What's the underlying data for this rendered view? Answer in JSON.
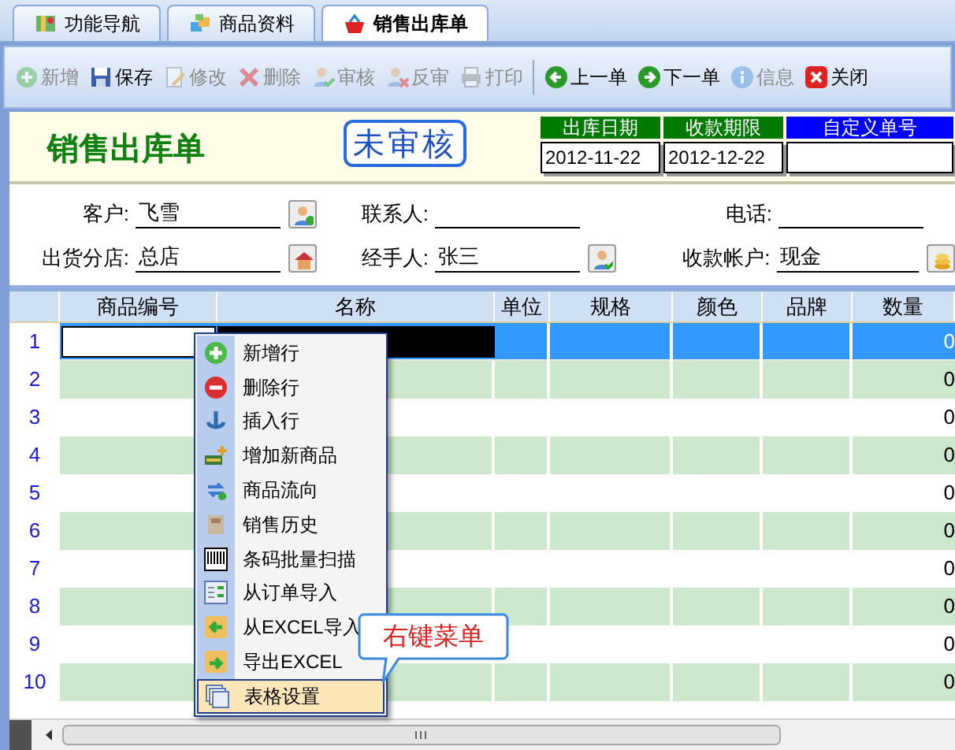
{
  "tabs": [
    {
      "label": "功能导航",
      "selected": false
    },
    {
      "label": "商品资料",
      "selected": false
    },
    {
      "label": "销售出库单",
      "selected": true
    }
  ],
  "toolbar": {
    "groups": [
      [
        {
          "label": "新增",
          "disabled": true
        },
        {
          "label": "保存",
          "disabled": false
        },
        {
          "label": "修改",
          "disabled": true
        },
        {
          "label": "删除",
          "disabled": true
        },
        {
          "label": "审核",
          "disabled": true
        },
        {
          "label": "反审",
          "disabled": true
        },
        {
          "label": "打印",
          "disabled": true
        }
      ],
      [
        {
          "label": "上一单",
          "disabled": false
        },
        {
          "label": "下一单",
          "disabled": false
        },
        {
          "label": "信息",
          "disabled": true
        },
        {
          "label": "关闭",
          "disabled": false
        }
      ]
    ]
  },
  "document": {
    "title": "销售出库单",
    "status": "未审核",
    "dates": [
      {
        "label": "出库日期",
        "value": "2012-11-22",
        "color": "#007a00"
      },
      {
        "label": "收款期限",
        "value": "2012-12-22",
        "color": "#007a00"
      },
      {
        "label": "自定义单号",
        "color": "#0000ff"
      }
    ]
  },
  "form": {
    "rows": [
      [
        {
          "label": "客户:",
          "value": "飞雪",
          "button": true
        },
        {
          "label": "联系人:",
          "button": false
        },
        {
          "label": "电话:",
          "button": false
        }
      ],
      [
        {
          "label": "出货分店:",
          "value": "总店",
          "button": true
        },
        {
          "label": "经手人:",
          "value": "张三",
          "button": true
        },
        {
          "label": "收款帐户:",
          "value": "现金",
          "button": true
        }
      ]
    ]
  },
  "grid": {
    "columns": [
      "商品编号",
      "名称",
      "单位",
      "规格",
      "颜色",
      "品牌",
      "数量"
    ],
    "rows": [
      {
        "number": "1",
        "quantity": "0",
        "selected": true
      },
      {
        "number": "2",
        "quantity": "0",
        "selected": false
      },
      {
        "number": "3",
        "quantity": "0",
        "selected": false
      },
      {
        "number": "4",
        "quantity": "0",
        "selected": false
      },
      {
        "number": "5",
        "quantity": "0",
        "selected": false
      },
      {
        "number": "6",
        "quantity": "0",
        "selected": false
      },
      {
        "number": "7",
        "quantity": "0",
        "selected": false
      },
      {
        "number": "8",
        "quantity": "0",
        "selected": false
      },
      {
        "number": "9",
        "quantity": "0",
        "selected": false
      },
      {
        "number": "10",
        "quantity": "0",
        "selected": false
      }
    ]
  },
  "context_menu": {
    "items": [
      {
        "label": "新增行",
        "selected": false
      },
      {
        "label": "删除行",
        "selected": false
      },
      {
        "label": "插入行",
        "selected": false
      },
      {
        "label": "增加新商品",
        "selected": false
      },
      {
        "label": "商品流向",
        "selected": false
      },
      {
        "label": "销售历史",
        "selected": false
      },
      {
        "label": "条码批量扫描",
        "selected": false
      },
      {
        "label": "从订单导入",
        "selected": false
      },
      {
        "label": "从EXCEL导入",
        "selected": false
      },
      {
        "label": "导出EXCEL",
        "selected": false
      },
      {
        "label": "表格设置",
        "selected": true
      }
    ]
  },
  "callout": {
    "text": "右键菜单"
  }
}
